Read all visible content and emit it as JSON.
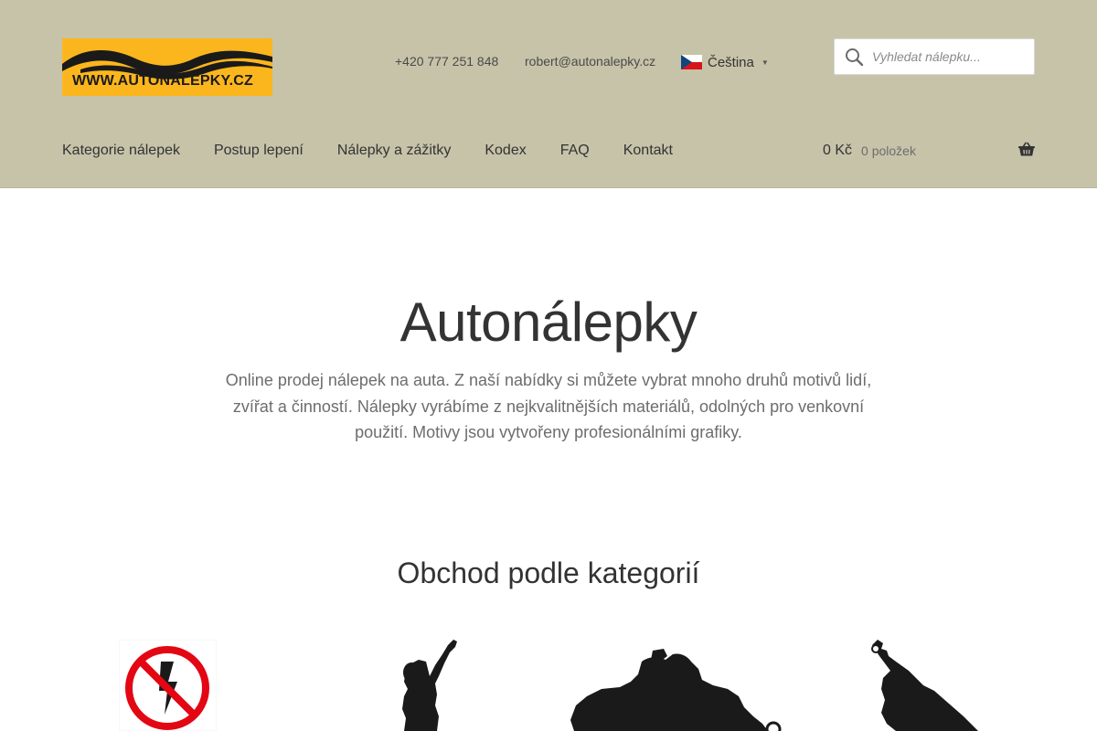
{
  "header": {
    "logo_text": "WWW.AUTONALEPKY.CZ",
    "phone": "+420 777 251 848",
    "email": "robert@autonalepky.cz",
    "language": {
      "label": "Čeština",
      "flag_icon": "czech-flag-icon"
    },
    "search": {
      "placeholder": "Vyhledat nálepku..."
    },
    "nav": [
      {
        "label": "Kategorie nálepek"
      },
      {
        "label": "Postup lepení"
      },
      {
        "label": "Nálepky a zážitky"
      },
      {
        "label": "Kodex"
      },
      {
        "label": "FAQ"
      },
      {
        "label": "Kontakt"
      }
    ],
    "cart": {
      "amount": "0 Kč",
      "count": "0 položek",
      "icon": "basket-icon"
    }
  },
  "hero": {
    "title": "Autonálepky",
    "description": "Online prodej nálepek na auta. Z naší nabídky si můžete vybrat mnoho druhů motivů lidí, zvířat a činností. Nálepky vyrábíme z nejkvalitnějších materiálů, odolných pro venkovní použití. Motivy jsou vytvořeny profesionálními grafiky."
  },
  "categories": {
    "title": "Obchod podle kategorií",
    "items": [
      {
        "icon": "no-electricity-sign-icon"
      },
      {
        "icon": "child-silhouette-icon"
      },
      {
        "icon": "atv-rider-silhouette-icon"
      },
      {
        "icon": "cello-silhouette-icon"
      }
    ]
  },
  "colors": {
    "header_bg": "#c6c3a9",
    "logo_bg": "#fcb61d",
    "prohibition_red": "#e30613"
  }
}
